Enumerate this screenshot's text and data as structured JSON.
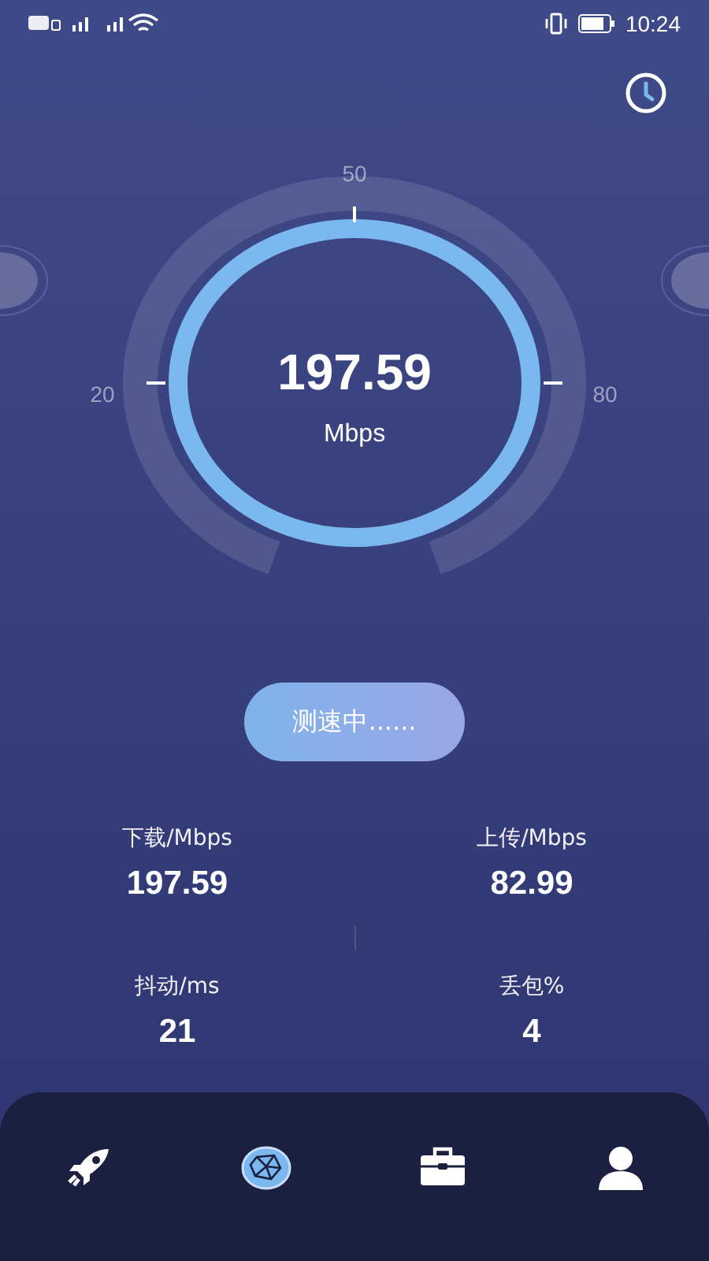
{
  "status_bar": {
    "time": "10:24"
  },
  "gauge": {
    "value": "197.59",
    "unit": "Mbps",
    "scale_labels": [
      "20",
      "50",
      "80"
    ]
  },
  "test_button": {
    "label": "测速中......"
  },
  "stats": [
    {
      "label": "下载/Mbps",
      "value": "197.59"
    },
    {
      "label": "上传/Mbps",
      "value": "82.99"
    },
    {
      "label": "抖动/ms",
      "value": "21"
    },
    {
      "label": "丢包%",
      "value": "4"
    }
  ],
  "nav": [
    {
      "kind": "rocket",
      "selected": false
    },
    {
      "kind": "globe",
      "selected": true
    },
    {
      "kind": "briefcase",
      "selected": false
    },
    {
      "kind": "person",
      "selected": false
    }
  ]
}
